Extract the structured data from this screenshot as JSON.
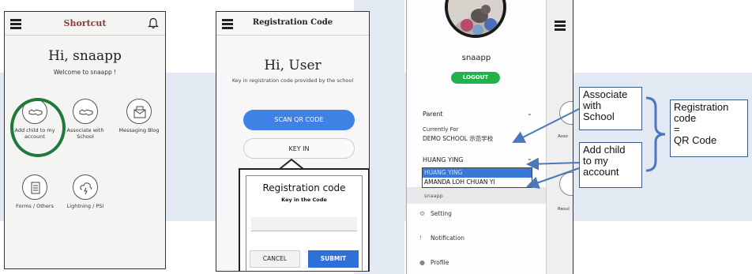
{
  "screen1": {
    "title": "Shortcut",
    "greeting": "Hi, snaapp",
    "welcome": "Welcome to snaapp !",
    "tiles": [
      {
        "label": "Add child to my account",
        "icon": "handshake-icon"
      },
      {
        "label": "Associate with School",
        "icon": "handshake-icon"
      },
      {
        "label": "Messaging Blog",
        "icon": "envelope-icon"
      },
      {
        "label": "Forms / Others",
        "icon": "document-icon"
      },
      {
        "label": "Lightning / PSI",
        "icon": "cloud-lightning-icon"
      }
    ]
  },
  "screen2": {
    "title": "Registration Code",
    "greeting": "Hi, User",
    "info": "Key in registration code provided by the school",
    "scan_button": "SCAN QR CODE",
    "keyin_button": "KEY IN",
    "dialog": {
      "title": "Registration code",
      "subtitle": "Key in the Code",
      "cancel": "CANCEL",
      "submit": "SUBMIT"
    }
  },
  "screen3": {
    "username": "snaapp",
    "logout": "LOGOUT",
    "parent_label": "Parent",
    "currently_for": "Currently For",
    "school": "DEMO SCHOOL 示范学校",
    "selected_child": "HUANG YING",
    "child_options": [
      "HUANG YING",
      "AMANDA LOH CHUAN YI"
    ],
    "snaapp_small": "snaapp",
    "menu": [
      {
        "label": "Setting",
        "icon": "gear-icon"
      },
      {
        "label": "Notification",
        "icon": "exclamation-icon"
      },
      {
        "label": "Profile",
        "icon": "person-icon"
      }
    ],
    "peek_labels": [
      "Asso",
      "Resul"
    ]
  },
  "annotations": {
    "associate": "Associate with School",
    "addchild": "Add child to my account",
    "registration": "Registration code = QR Code",
    "associate_lines": [
      "Associate",
      "with",
      "School"
    ],
    "addchild_lines": [
      "Add child",
      "to my",
      "account"
    ],
    "registration_lines": [
      "Registration",
      "code",
      "=",
      "QR Code"
    ]
  },
  "colors": {
    "highlight_ring": "#1f7a3a",
    "primary_blue": "#3f82e6",
    "logout_green": "#22b24c",
    "background_band": "#e3e9f2"
  }
}
